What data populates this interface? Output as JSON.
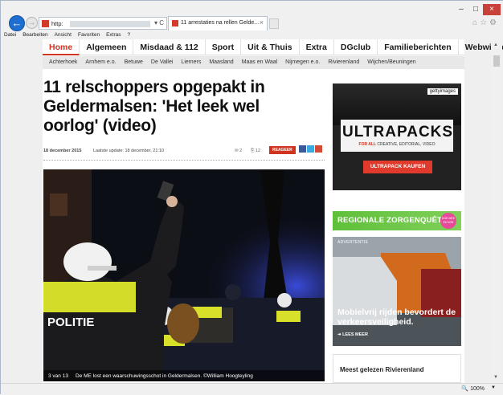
{
  "browser": {
    "address_protocol": "http:",
    "address_controls": "▾ C",
    "tab_title": "11 arrestaties na rellen Gelde...",
    "tab_close": "×",
    "menu": [
      "Datei",
      "Bearbeiten",
      "Ansicht",
      "Favoriten",
      "Extras",
      "?"
    ],
    "window_controls": {
      "minimize": "–",
      "maximize": "□",
      "close": "×"
    },
    "zoom": "100%"
  },
  "site": {
    "main_nav": [
      "Home",
      "Algemeen",
      "Misdaad & 112",
      "Sport",
      "Uit & Thuis",
      "Extra",
      "DGclub",
      "Familieberichten",
      "Webwinkel"
    ],
    "active_nav": "Home",
    "sub_nav": [
      "Achterhoek",
      "Arnhem e.o.",
      "Betuwe",
      "De Vallei",
      "Liemers",
      "Maasland",
      "Maas en Waal",
      "Nijmegen e.o.",
      "Rivierenland",
      "Wijchen/Beuningen"
    ]
  },
  "article": {
    "headline": "11 relschoppers opgepakt in Geldermalsen: 'Het leek wel oorlog' (video)",
    "date": "18 december 2015",
    "update": "Laatste update: 18 december, 21:10",
    "count1": "2",
    "count2": "12",
    "reageer": "REAGEER",
    "photo": {
      "counter": "3 van 13",
      "caption": "De ME lost een waarschuwingsschot in Geldermalsen. ©William Hoogteyling",
      "vest_text": "POLITIE"
    }
  },
  "sidebar": {
    "ad1": {
      "getty": "gettyimages",
      "title": "ULTRAPACKS",
      "tagline_prefix": "FOR ALL",
      "tagline_rest": "CREATIVE, EDITORIAL, VIDEO",
      "button": "ULTRAPACK KAUFEN"
    },
    "zorg": {
      "title": "REGIONALE ZORGENQUÊTE",
      "badge": "DOE MEE EN WIN"
    },
    "ad2": {
      "label": "ADVERTENTIE",
      "headline": "Mobielvrij rijden bevordert de verkeersveiligheid.",
      "more": "➜ LEES MEER"
    },
    "meest_gelezen": "Meest gelezen Rivierenland"
  },
  "colors": {
    "accent": "#d0331f",
    "ie_blue": "#1e6fd0",
    "zorg_green": "#5fbf3a"
  }
}
